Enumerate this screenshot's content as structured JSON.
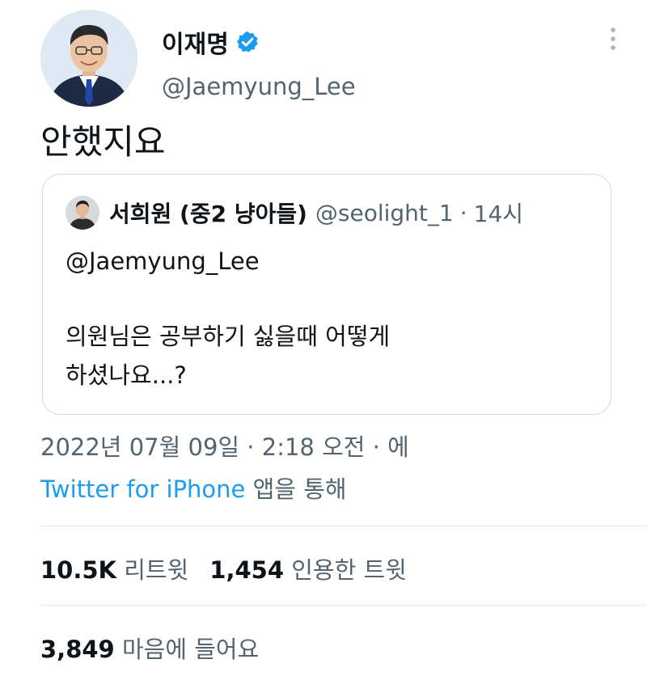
{
  "author": {
    "name": "이재명",
    "handle": "@Jaemyung_Lee",
    "verified": true,
    "avatar": "profile-photo",
    "verified_icon": "verified-badge-icon",
    "more_icon": "more-options-icon"
  },
  "tweet": {
    "text": "안했지요"
  },
  "quoted_tweet": {
    "avatar": "profile-photo-small",
    "name": "서희원 (중2 냥아들)",
    "handle": "@seolight_1",
    "separator": "·",
    "time": "14시",
    "mention": "@Jaemyung_Lee",
    "body": "의원님은 공부하기 싫을때 어떻게\n하셨나요...?"
  },
  "meta": {
    "date_line": "2022년 07월 09일 · 2:18 오전 · 에",
    "source": "Twitter for iPhone",
    "source_suffix": " 앱을 통해"
  },
  "stats": {
    "retweets_count": "10.5K",
    "retweets_label": "리트윗",
    "quotes_count": "1,454",
    "quotes_label": "인용한 트윗",
    "likes_count": "3,849",
    "likes_label": "마음에 들어요"
  },
  "colors": {
    "primary_text": "#0f1419",
    "secondary_text": "#536471",
    "accent_blue": "#1d9bf0",
    "border": "#cfd9de"
  }
}
